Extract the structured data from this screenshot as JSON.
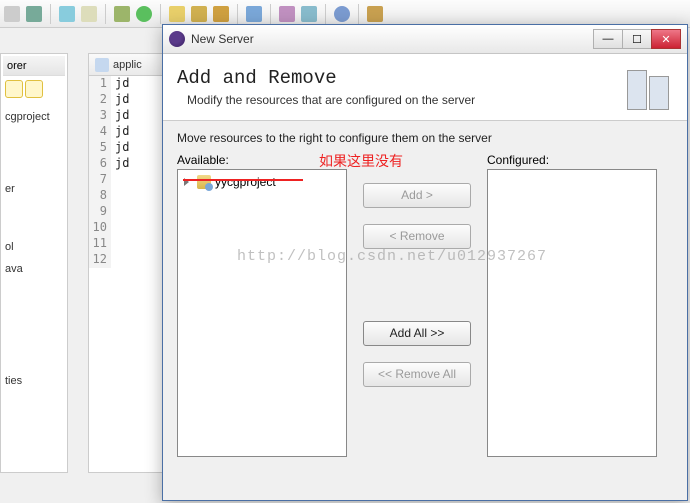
{
  "toolbar_icons": [
    "save",
    "wand",
    "debug",
    "run",
    "winbuilder",
    "pkg",
    "search",
    "tools",
    "ext",
    "team",
    "web",
    "browser",
    "help",
    "user"
  ],
  "left_panel": {
    "header": "orer",
    "items": [
      "cgproject",
      "",
      "er",
      "",
      "ol",
      "ava",
      "",
      "",
      "",
      "ties",
      ""
    ]
  },
  "editor": {
    "tab_label": "applic",
    "lines": [
      "jd",
      "jd",
      "jd",
      "jd",
      "jd",
      "jd",
      "",
      "",
      "",
      "",
      "",
      ""
    ]
  },
  "dialog": {
    "title": "New Server",
    "heading": "Add and Remove",
    "subheading": "Modify the resources that are configured on the server",
    "instruction": "Move resources to the right to configure them on the server",
    "available_label": "Available:",
    "configured_label": "Configured:",
    "available_items": [
      {
        "label": "yycgproject"
      }
    ],
    "buttons": {
      "add": "Add >",
      "remove": "< Remove",
      "add_all": "Add All >>",
      "remove_all": "<< Remove All"
    }
  },
  "annotation": {
    "text": "如果这里没有"
  },
  "watermark": "http://blog.csdn.net/u012937267"
}
